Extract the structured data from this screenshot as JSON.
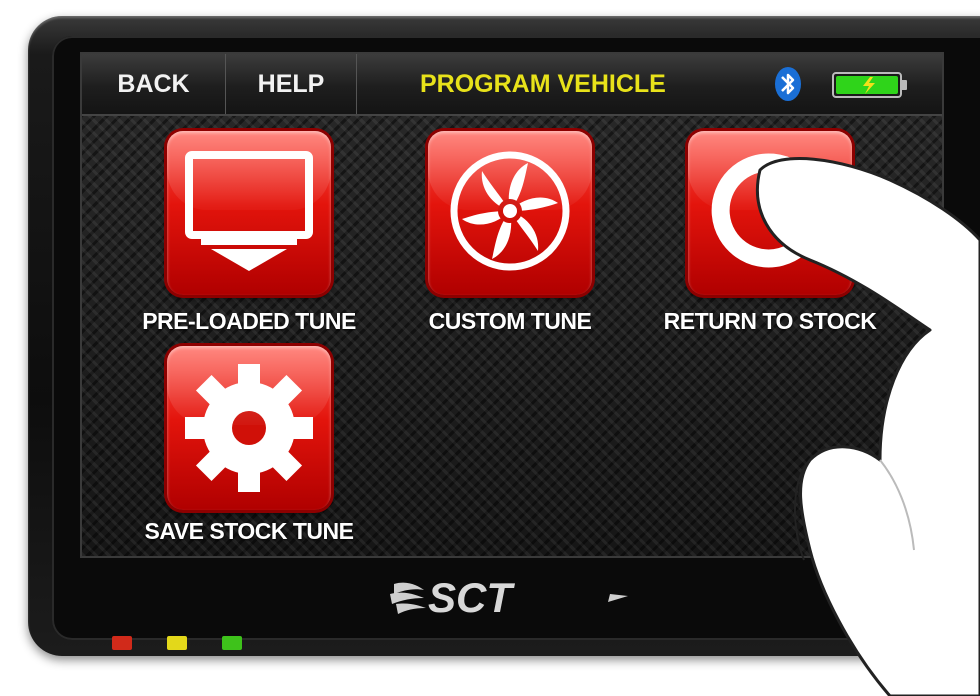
{
  "header": {
    "back_label": "BACK",
    "help_label": "HELP",
    "title": "PROGRAM VEHICLE",
    "title_color": "#e8e21a",
    "bluetooth_icon": "bluetooth-icon",
    "battery_icon": "battery-charging-icon"
  },
  "menu": {
    "items": [
      {
        "label": "PRE-LOADED TUNE",
        "icon": "monitor-download-icon"
      },
      {
        "label": "CUSTOM TUNE",
        "icon": "fan-icon"
      },
      {
        "label": "RETURN TO STOCK",
        "icon": "return-arrow-icon"
      },
      {
        "label": "SAVE STOCK TUNE",
        "icon": "gear-icon"
      }
    ]
  },
  "brand": {
    "logo_text": "SCT"
  },
  "indicators": {
    "leds": [
      {
        "name": "red-led",
        "color": "#d12a1a"
      },
      {
        "name": "yellow-led",
        "color": "#e3d81a"
      },
      {
        "name": "green-led",
        "color": "#3ec21b"
      }
    ]
  },
  "colors": {
    "tile_red": "#e3140c",
    "screen_bg": "#1a1a1a"
  }
}
